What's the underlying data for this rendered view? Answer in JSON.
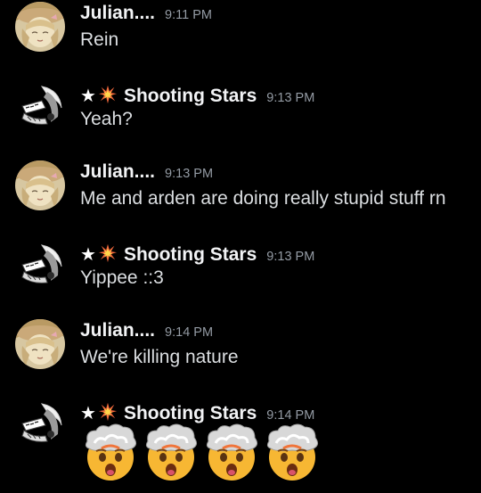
{
  "messages": [
    {
      "author": "Julian....",
      "avatar_icon": "julian-avatar",
      "time": "9:11 PM",
      "text": "Rein"
    },
    {
      "author": "Shooting Stars",
      "author_prefix_icons": [
        "star-icon",
        "collision-icon"
      ],
      "avatar_icon": "shooting-stars-avatar",
      "time": "9:13 PM",
      "text": "Yeah?"
    },
    {
      "author": "Julian....",
      "avatar_icon": "julian-avatar",
      "time": "9:13 PM",
      "text": "Me and arden are doing really stupid stuff rn"
    },
    {
      "author": "Shooting Stars",
      "author_prefix_icons": [
        "star-icon",
        "collision-icon"
      ],
      "avatar_icon": "shooting-stars-avatar",
      "time": "9:13 PM",
      "text": "Yippee ::3"
    },
    {
      "author": "Julian....",
      "avatar_icon": "julian-avatar",
      "time": "9:14 PM",
      "text": "We're killing nature"
    },
    {
      "author": "Shooting Stars",
      "author_prefix_icons": [
        "star-icon",
        "collision-icon"
      ],
      "avatar_icon": "shooting-stars-avatar",
      "time": "9:14 PM",
      "emojis": [
        "exploding-head-emoji",
        "exploding-head-emoji",
        "exploding-head-emoji",
        "exploding-head-emoji"
      ]
    }
  ],
  "star_glyph": "★",
  "colors": {
    "background": "#000000",
    "username": "#f2f3f5",
    "timestamp": "#949ba4",
    "message_text": "#dbdee1"
  }
}
